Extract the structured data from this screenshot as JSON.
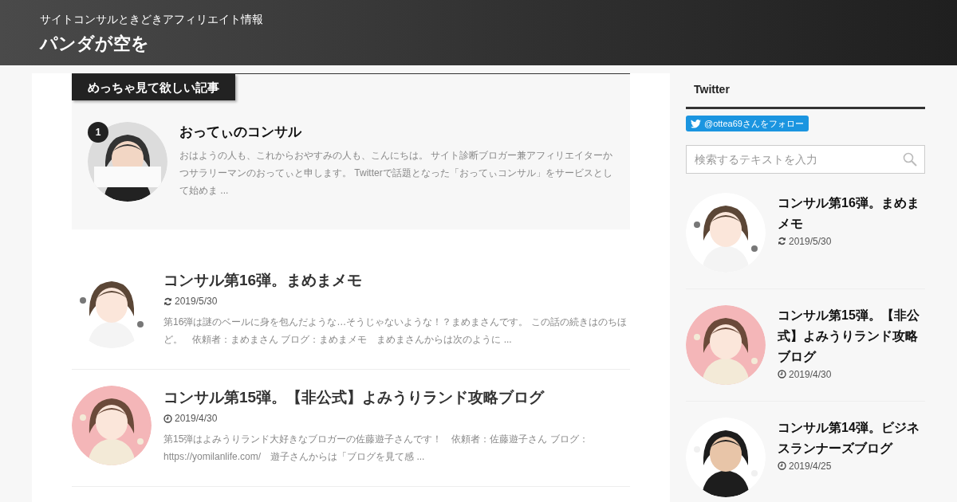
{
  "header": {
    "subtitle": "サイトコンサルときどきアフィリエイト情報",
    "title": "パンダが空を"
  },
  "featured": {
    "tab_label": "めっちゃ見て欲しい記事",
    "posts": [
      {
        "rank": "1",
        "title": "おってぃのコンサル",
        "excerpt": "おはようの人も、これからおやすみの人も、こんにちは。 サイト診断ブロガー兼アフィリエイターかつサラリーマンのおってぃと申します。 Twitterで話題となった「おってぃコンサル」をサービスとして始めま ..."
      }
    ]
  },
  "posts": [
    {
      "title": "コンサル第16弾。まめまメモ",
      "kind": "updated",
      "date": "2019/5/30",
      "excerpt": "第16弾は謎のベールに身を包んだような…そうじゃないような！？まめまさんです。 この話の続きはのちほど。　依頼者：まめまさん ブログ：まめまメモ　まめまさんからは次のように ..."
    },
    {
      "title": "コンサル第15弾。【非公式】よみうりランド攻略ブログ",
      "kind": "published",
      "date": "2019/4/30",
      "excerpt": "第15弾はよみうりランド大好きなブロガーの佐藤遊子さんです！　依頼者：佐藤遊子さん ブログ：https://yomilanlife.com/　遊子さんからは「ブログを見て感 ..."
    }
  ],
  "sidebar": {
    "widget_title": "Twitter",
    "follow_button": "@ottea69さんをフォロー",
    "search": {
      "placeholder": "検索するテキストを入力"
    },
    "posts": [
      {
        "title": "コンサル第16弾。まめまメモ",
        "kind": "updated",
        "date": "2019/5/30"
      },
      {
        "title": "コンサル第15弾。【非公式】よみうりランド攻略ブログ",
        "kind": "published",
        "date": "2019/4/30"
      },
      {
        "title": "コンサル第14弾。ビジネスランナーズブログ",
        "kind": "published",
        "date": "2019/4/25"
      }
    ]
  }
}
